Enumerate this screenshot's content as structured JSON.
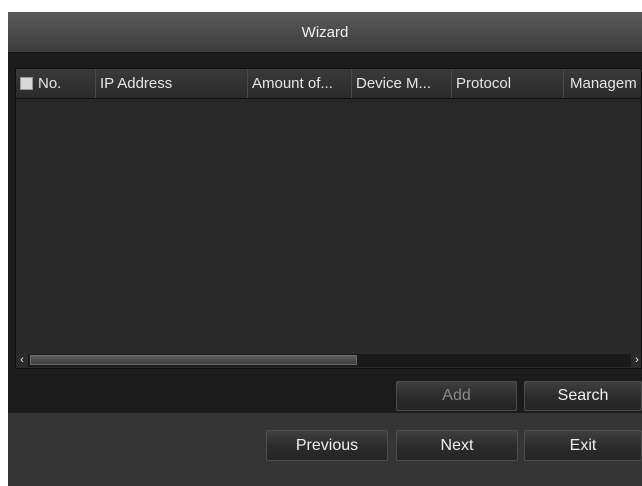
{
  "dialog": {
    "title": "Wizard"
  },
  "table": {
    "columns": [
      "No.",
      "IP Address",
      "Amount of...",
      "Device M...",
      "Protocol",
      "Managem"
    ],
    "rows": []
  },
  "scrollbar": {
    "left_arrow": "‹",
    "right_arrow": "›"
  },
  "actions": {
    "add_label": "Add",
    "search_label": "Search"
  },
  "footer": {
    "previous_label": "Previous",
    "next_label": "Next",
    "exit_label": "Exit"
  },
  "colors": {
    "background": "#1b1b1b",
    "titlebar": "#4a4a4a",
    "text": "#f0f0f0",
    "disabled_text": "#8b8b8b"
  }
}
